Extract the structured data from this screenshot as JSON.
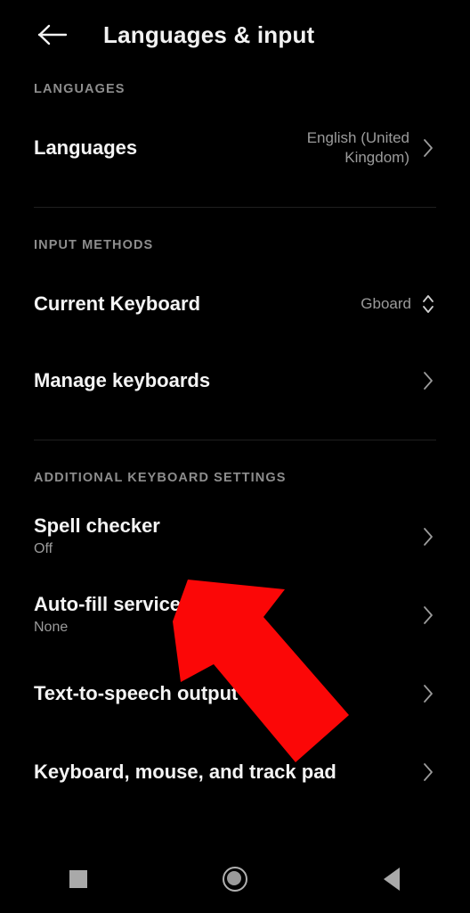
{
  "appbar": {
    "back_icon": "arrow-left-icon",
    "title": "Languages & input"
  },
  "sections": [
    {
      "header": "LANGUAGES",
      "rows": [
        {
          "title": "Languages",
          "value": "English (United Kingdom)",
          "accessory": "chevron-right-icon"
        }
      ]
    },
    {
      "header": "INPUT METHODS",
      "rows": [
        {
          "title": "Current Keyboard",
          "value": "Gboard",
          "accessory": "chevron-up-down-icon"
        },
        {
          "title": "Manage keyboards",
          "accessory": "chevron-right-icon"
        }
      ]
    },
    {
      "header": "ADDITIONAL KEYBOARD SETTINGS",
      "rows": [
        {
          "title": "Spell checker",
          "subtitle": "Off",
          "accessory": "chevron-right-icon"
        },
        {
          "title": "Auto-fill service",
          "subtitle": "None",
          "accessory": "chevron-right-icon"
        },
        {
          "title": "Text-to-speech output",
          "accessory": "chevron-right-icon"
        },
        {
          "title": "Keyboard, mouse, and track pad",
          "accessory": "chevron-right-icon"
        }
      ]
    }
  ],
  "annotation": {
    "type": "arrow",
    "color": "#fb0707",
    "points_to": "Spell checker"
  },
  "navbar": {
    "recents_icon": "square-recents-icon",
    "home_icon": "circle-home-icon",
    "back_icon": "triangle-back-icon"
  },
  "colors": {
    "background": "#000000",
    "primary_text": "#f4f4f4",
    "secondary_text": "#9b9b9b",
    "section_header_text": "#8d8d8d",
    "divider": "#1f1f1f",
    "annotation_red": "#fb0707"
  }
}
